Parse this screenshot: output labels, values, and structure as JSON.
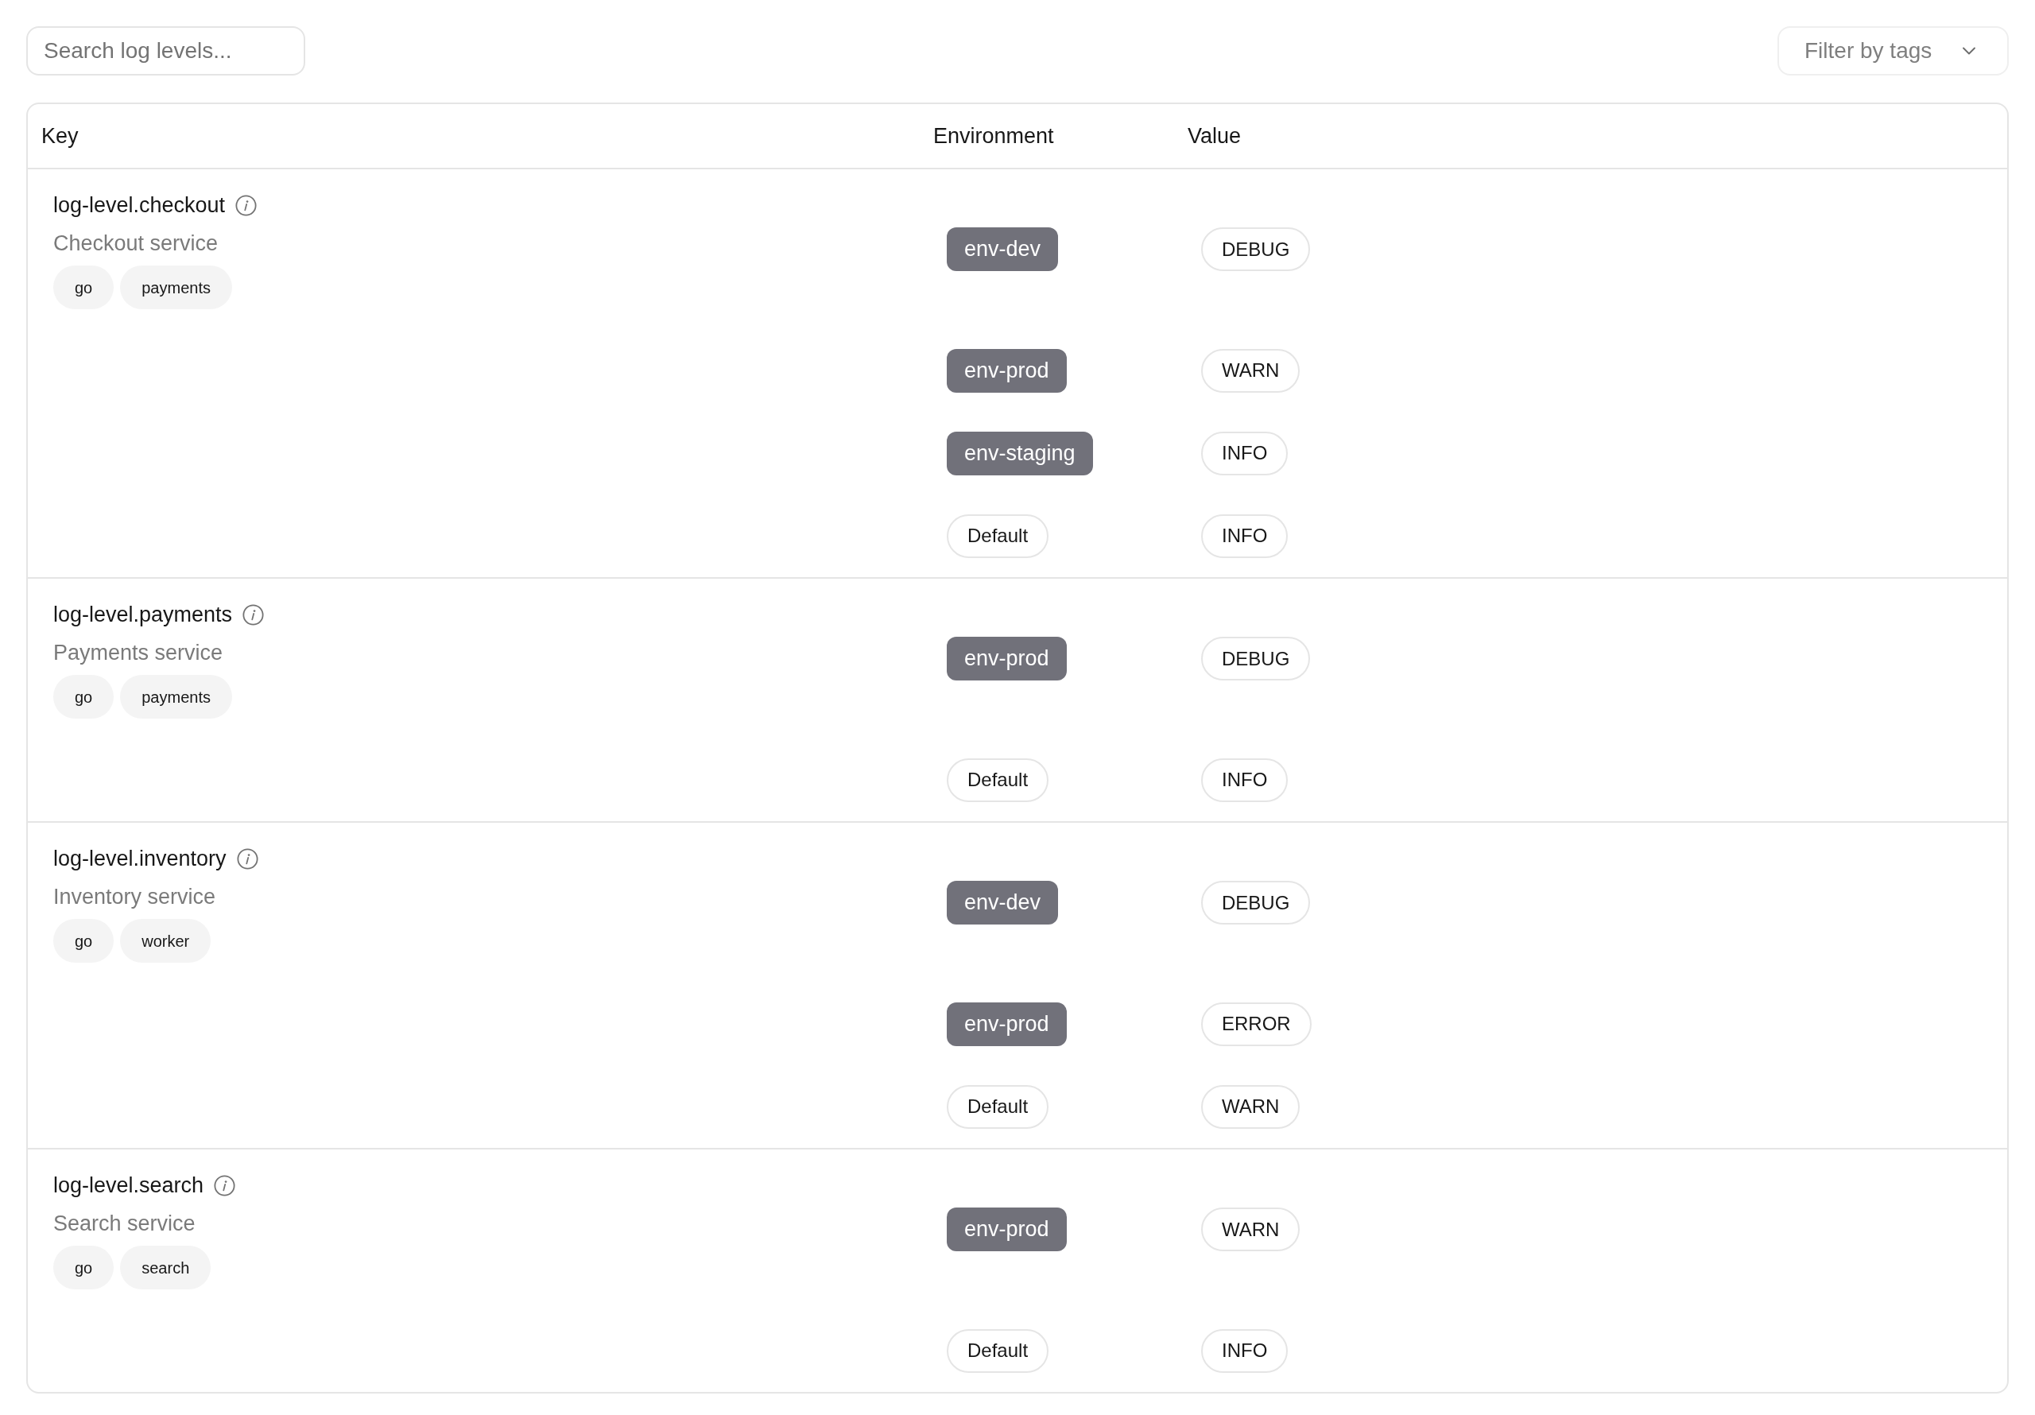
{
  "search": {
    "placeholder": "Search log levels..."
  },
  "filter": {
    "label": "Filter by tags"
  },
  "table": {
    "columns": [
      "Key",
      "Environment",
      "Value"
    ],
    "rows": [
      {
        "key": "log-level.checkout",
        "description": "Checkout service",
        "tags": [
          "go",
          "payments"
        ],
        "overrides": [
          {
            "kind": "environment",
            "environment": "env-dev",
            "value": "DEBUG"
          },
          {
            "kind": "environment",
            "environment": "env-prod",
            "value": "WARN"
          },
          {
            "kind": "environment",
            "environment": "env-staging",
            "value": "INFO"
          },
          {
            "kind": "default",
            "environment": "Default",
            "value": "INFO"
          }
        ]
      },
      {
        "key": "log-level.payments",
        "description": "Payments service",
        "tags": [
          "go",
          "payments"
        ],
        "overrides": [
          {
            "kind": "environment",
            "environment": "env-prod",
            "value": "DEBUG"
          },
          {
            "kind": "default",
            "environment": "Default",
            "value": "INFO"
          }
        ]
      },
      {
        "key": "log-level.inventory",
        "description": "Inventory service",
        "tags": [
          "go",
          "worker"
        ],
        "overrides": [
          {
            "kind": "environment",
            "environment": "env-dev",
            "value": "DEBUG"
          },
          {
            "kind": "environment",
            "environment": "env-prod",
            "value": "ERROR"
          },
          {
            "kind": "default",
            "environment": "Default",
            "value": "WARN"
          }
        ]
      },
      {
        "key": "log-level.search",
        "description": "Search service",
        "tags": [
          "go",
          "search"
        ],
        "overrides": [
          {
            "kind": "environment",
            "environment": "env-prod",
            "value": "WARN"
          },
          {
            "kind": "default",
            "environment": "Default",
            "value": "INFO"
          }
        ]
      }
    ]
  }
}
